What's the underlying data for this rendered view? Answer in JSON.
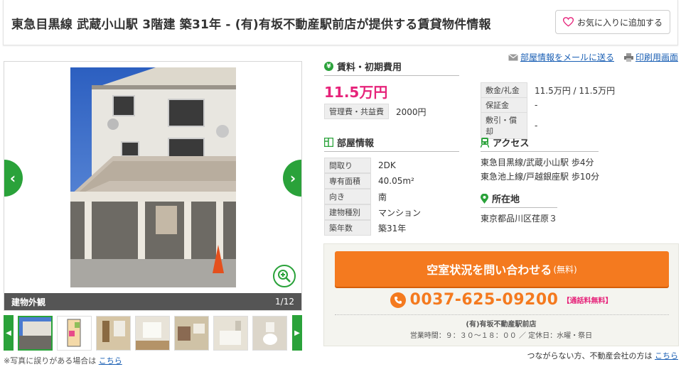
{
  "header": {
    "title": "東急目黒線 武蔵小山駅 3階建 築31年 - (有)有坂不動産駅前店が提供する賃貸物件情報",
    "favorite_label": "お気に入りに追加する"
  },
  "gallery": {
    "caption": "建物外観",
    "counter": "1/12",
    "note_text": "※写真に誤りがある場合は",
    "note_link": "こちら"
  },
  "links": {
    "mail": "部屋情報をメールに送る",
    "print": "印刷用画面"
  },
  "fees": {
    "heading": "賃料・初期費用",
    "rent": "11.5万円",
    "mgmt_label": "管理費・共益費",
    "mgmt_value": "2000円",
    "rows": [
      {
        "label": "敷金/礼金",
        "value": "11.5万円 / 11.5万円"
      },
      {
        "label": "保証金",
        "value": "-"
      },
      {
        "label": "敷引・償却",
        "value": "-"
      }
    ]
  },
  "room": {
    "heading": "部屋情報",
    "rows": [
      {
        "label": "間取り",
        "value": "2DK"
      },
      {
        "label": "専有面積",
        "value": "40.05m²"
      },
      {
        "label": "向き",
        "value": "南"
      },
      {
        "label": "建物種別",
        "value": "マンション"
      },
      {
        "label": "築年数",
        "value": "築31年"
      }
    ]
  },
  "access": {
    "heading": "アクセス",
    "lines": [
      "東急目黒線/武蔵小山駅 歩4分",
      "東急池上線/戸越銀座駅 歩10分"
    ]
  },
  "location": {
    "heading": "所在地",
    "address": "東京都品川区荏原３"
  },
  "contact": {
    "cta_main": "空室状況を問い合わせる",
    "cta_sub": "(無料)",
    "phone": "0037-625-09200",
    "phone_free": "【通話料無料】",
    "agency": "(有)有坂不動産駅前店",
    "hours": "営業時間：９：３０〜１８：００ ／ 定休日：水曜・祭日"
  },
  "footer": {
    "note_text": "つながらない方、不動産会社の方は",
    "note_link": "こちら"
  },
  "colors": {
    "accent_green": "#2aa23a",
    "rent_pink": "#e6237a",
    "cta_orange": "#f47a1f",
    "link_blue": "#1a5fb4"
  }
}
